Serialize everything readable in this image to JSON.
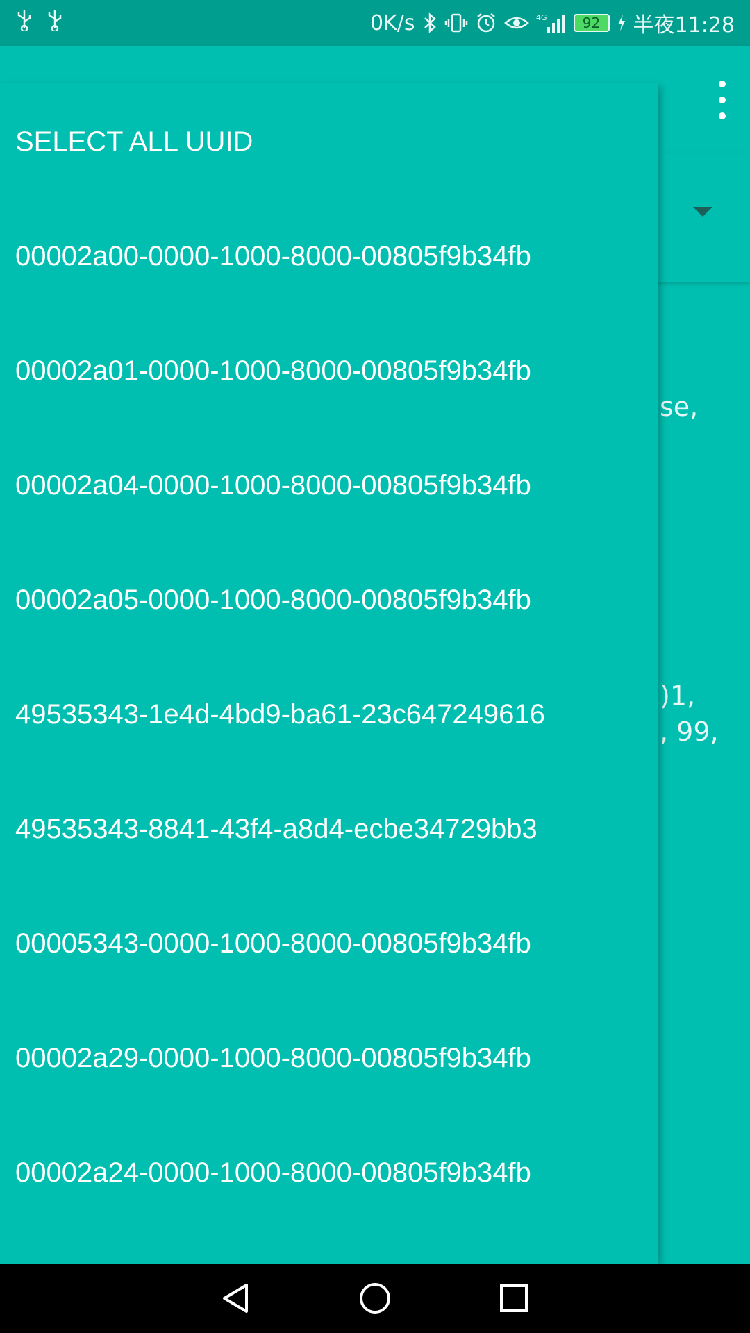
{
  "status_bar": {
    "left_icons": [
      "usb-icon",
      "usb-icon"
    ],
    "net_speed": "0K/s",
    "icons": [
      "bluetooth-icon",
      "vibrate-icon",
      "alarm-icon",
      "eye-icon",
      "signal-4g-icon"
    ],
    "battery": "92",
    "time": "半夜11:28"
  },
  "toolbar": {
    "more_icon": "more-vert-icon"
  },
  "background": {
    "snippet_1": "se,",
    "snippet_2": ")1,",
    "snippet_3": ", 99,"
  },
  "menu": {
    "items": [
      "SELECT ALL UUID",
      "00002a00-0000-1000-8000-00805f9b34fb",
      "00002a01-0000-1000-8000-00805f9b34fb",
      "00002a04-0000-1000-8000-00805f9b34fb",
      "00002a05-0000-1000-8000-00805f9b34fb",
      "49535343-1e4d-4bd9-ba61-23c647249616",
      "49535343-8841-43f4-a8d4-ecbe34729bb3",
      "00005343-0000-1000-8000-00805f9b34fb",
      "00002a29-0000-1000-8000-00805f9b34fb",
      "00002a24-0000-1000-8000-00805f9b34fb"
    ]
  },
  "nav_bar": {
    "icons": [
      "back-icon",
      "home-icon",
      "recents-icon"
    ]
  },
  "colors": {
    "accent": "#00BFB0",
    "status_bar": "#009E8E",
    "nav_bar": "#000000"
  }
}
